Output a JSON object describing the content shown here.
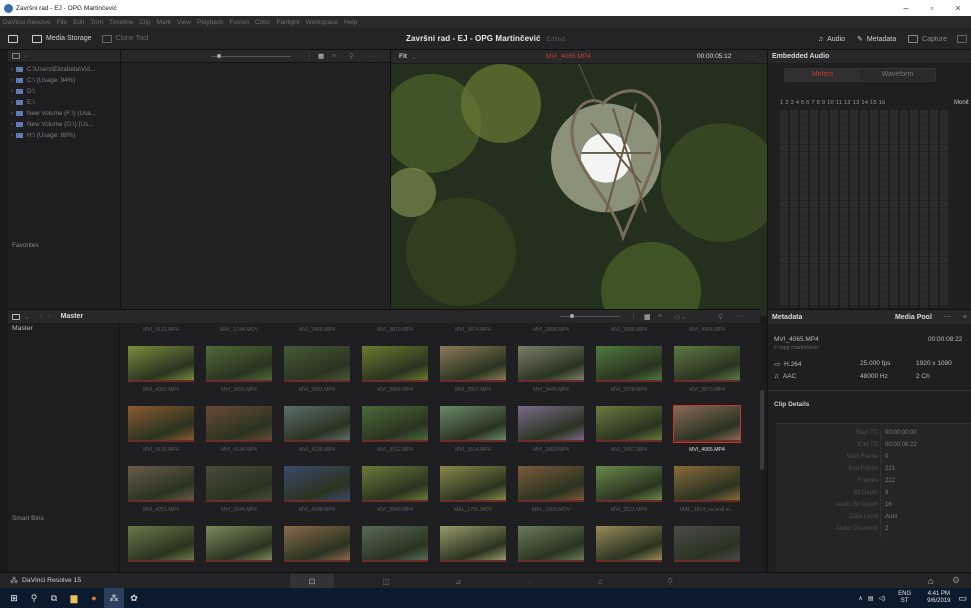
{
  "window": {
    "title": "Završni rad - EJ - OPG Martinčević",
    "minimize": "–",
    "maximize": "▫",
    "close": "×"
  },
  "menu": [
    "DaVinci Resolve",
    "File",
    "Edit",
    "Trim",
    "Timeline",
    "Clip",
    "Mark",
    "View",
    "Playback",
    "Fusion",
    "Color",
    "Fairlight",
    "Workspace",
    "Help"
  ],
  "toolbar": {
    "media_storage": "Media Storage",
    "clone_tool": "Clone Tool",
    "project_name": "Završni rad - EJ - OPG Martinčević",
    "project_status": "Edited",
    "audio": "Audio",
    "metadata": "Metadata",
    "capture": "Capture"
  },
  "storage": {
    "items": [
      "C:\\Users\\Elizabeta\\Vid...",
      "C:\\ (Usage: 94%)",
      "D:\\",
      "E:\\",
      "New Volume (F:\\) (Usa...",
      "New Volume (G:\\) (Us...",
      "H:\\ (Usage: 88%)"
    ],
    "favorites": "Favorites"
  },
  "viewer": {
    "zoom": "Fit",
    "clip_name": "MVI_4065.MP4",
    "timecode": "00:00:05:12"
  },
  "audio_panel": {
    "title": "Embedded Audio",
    "tab_meters": "Meters",
    "tab_waveform": "Waveform",
    "channels": "1  2  3  4  5  6  7  8  9  10 11 12 13 14 15 16",
    "monitor": "Monit",
    "accent_color": "#c3402f"
  },
  "bin": {
    "folder": "Master",
    "master": "Master",
    "smart_bins": "Smart Bins",
    "top_captions": [
      "MVI_4121.MP4",
      "MAL_1744.MOV",
      "MVI_3466.MP4",
      "MVI_3879.MP4",
      "MVI_3874.MP4",
      "MVI_3898.MP4",
      "MVI_3886.MP4",
      "MVI_4064.MP4"
    ],
    "rows": [
      {
        "captions": [
          "MVI_4062.MP4",
          "MVI_3895.MP4",
          "MVI_3902.MP4",
          "MVI_3884.MP4",
          "MVI_3897.MP4",
          "MVI_3445.MP4",
          "MVI_3978.MP4",
          "MVI_3873.MP4"
        ],
        "colors": [
          "#7a8c3e",
          "#4f6a3a",
          "#465a37",
          "#6b7a2e",
          "#8a7a5a",
          "#7a7f6a",
          "#4f7a3e",
          "#5d7a45"
        ]
      },
      {
        "captions": [
          "MVI_4133.MP4",
          "MVI_4134.MP4",
          "MVI_4136.MP4",
          "MVI_3512.MP4",
          "MVI_3514.MP4",
          "MVI_3453.MP4",
          "MVI_3457.MP4",
          "MVI_4065.MP4"
        ],
        "colors": [
          "#8a5a30",
          "#6a4a38",
          "#5a6e6a",
          "#4a6a3a",
          "#6a8a6a",
          "#7a6a8a",
          "#6a7a3e",
          "#8a6a5a"
        ]
      },
      {
        "captions": [
          "MVI_4051.MP4",
          "MVI_3944.MP4",
          "MVI_4048.MP4",
          "MVI_3946.MP4",
          "MAL_1791.MOV",
          "MAL_1809.MOV",
          "MVI_3522.MP4",
          "MAL_1814_na brdi ei..."
        ],
        "colors": [
          "#6a5a4a",
          "#4a4a3a",
          "#3a4a6a",
          "#6a7a3a",
          "#8a8a4a",
          "#7a5a3a",
          "#6a8a4a",
          "#8a6a3a"
        ]
      },
      {
        "captions": [
          "",
          "",
          "",
          "",
          "",
          "",
          "",
          ""
        ],
        "colors": [
          "#6a7a4a",
          "#7a8a5a",
          "#8a6a4a",
          "#5a6a5a",
          "#9a9a6a",
          "#6a7a5a",
          "#9a8a5a",
          "#4a4a4a"
        ]
      }
    ],
    "selected": "MVI_4065.MP4"
  },
  "metadata": {
    "title": "Metadata",
    "media_pool": "Media Pool",
    "clip": "MVI_4065.MP4",
    "clip_duration": "00:00:08:22",
    "path": "F:\\opg martinčević",
    "codec": "H.264",
    "fps": "25.000 fps",
    "resolution": "1920 x 1080",
    "audio_codec": "AAC",
    "sample_rate": "48000 Hz",
    "channels": "2 Ch",
    "clip_details": "Clip Details",
    "details": [
      [
        "Start TC",
        "00:00:00:00"
      ],
      [
        "End TC",
        "00:00:08:22"
      ],
      [
        "Start Frame",
        "0"
      ],
      [
        "End Frame",
        "221"
      ],
      [
        "Frames",
        "222"
      ],
      [
        "Bit Depth",
        "8"
      ],
      [
        "Audio Bit Depth",
        "16"
      ],
      [
        "Data Level",
        "Auto"
      ],
      [
        "Audio Channels",
        "2"
      ]
    ]
  },
  "pagebar": {
    "app": "DaVinci Resolve 15"
  },
  "taskbar": {
    "lang": "ENG",
    "lang2": "ST",
    "time": "4:41 PM",
    "date": "9/6/2019"
  }
}
